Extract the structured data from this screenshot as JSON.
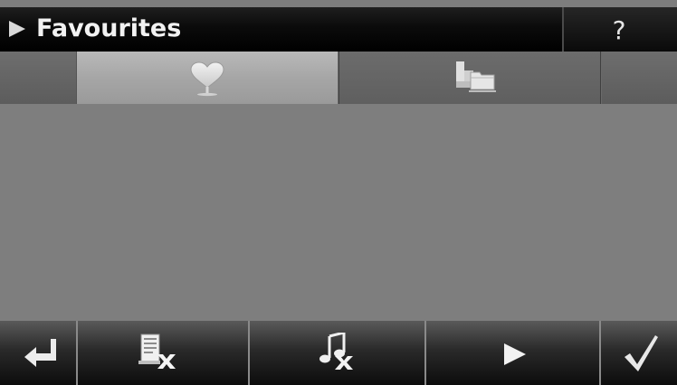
{
  "header": {
    "title": "Favourites",
    "help_label": "?"
  },
  "tabs": [
    {
      "icon": "heart-icon",
      "selected": true
    },
    {
      "icon": "folder-icon",
      "selected": false
    }
  ],
  "toolbar": {
    "buttons": [
      {
        "icon": "back-arrow-icon"
      },
      {
        "icon": "delete-list-icon"
      },
      {
        "icon": "delete-music-icon"
      },
      {
        "icon": "play-icon"
      },
      {
        "icon": "checkmark-icon"
      }
    ]
  },
  "colors": {
    "title_bar": "#000000",
    "background": "#7d7d7d",
    "tab_selected": "#a8a8a8",
    "toolbar": "#1a1a1a"
  }
}
